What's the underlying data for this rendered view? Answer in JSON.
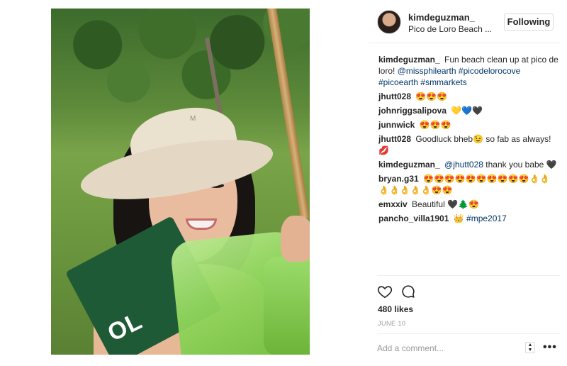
{
  "post": {
    "image_alt": "Selfie of a woman in a bucket hat holding a green bag at a beach clean up",
    "sash_text": "OL"
  },
  "header": {
    "username": "kimdeguzman_",
    "location": "Pico de Loro Beach ...",
    "follow_label": "Following"
  },
  "caption": {
    "user": "kimdeguzman_",
    "text": "Fun beach clean up at pico de loro!",
    "tags": [
      "@missphilearth",
      "#picodelorocove",
      "#picoearth",
      "#smmarkets"
    ]
  },
  "comments": [
    {
      "user": "jhutt028",
      "text": "😍😍😍"
    },
    {
      "user": "johnriggsalipova",
      "text": "💛💙🖤"
    },
    {
      "user": "junnwick",
      "text": "😍😍😍"
    },
    {
      "user": "jhutt028",
      "text": "Goodluck bheb😉 so fab as always!💋"
    },
    {
      "user": "kimdeguzman_",
      "text_prefix": "",
      "mention": "@jhutt028",
      "text": "thank you babe 🖤"
    },
    {
      "user": "bryan.g31",
      "text": "😍😍😍😍😍😍😍😍😍😍👌👌👌👌👌👌👌😍😍"
    },
    {
      "user": "emxxiv",
      "text": "Beautiful 🖤🌲😍"
    },
    {
      "user": "pancho_villa1901",
      "text_prefix": "👑",
      "mention": "#mpe2017",
      "text": ""
    }
  ],
  "stats": {
    "likes": "480 likes",
    "date": "JUNE 10"
  },
  "comment_box": {
    "placeholder": "Add a comment..."
  },
  "icons": {
    "like": "heart-icon",
    "comment": "speech-bubble-icon",
    "more": "more-options-icon"
  }
}
